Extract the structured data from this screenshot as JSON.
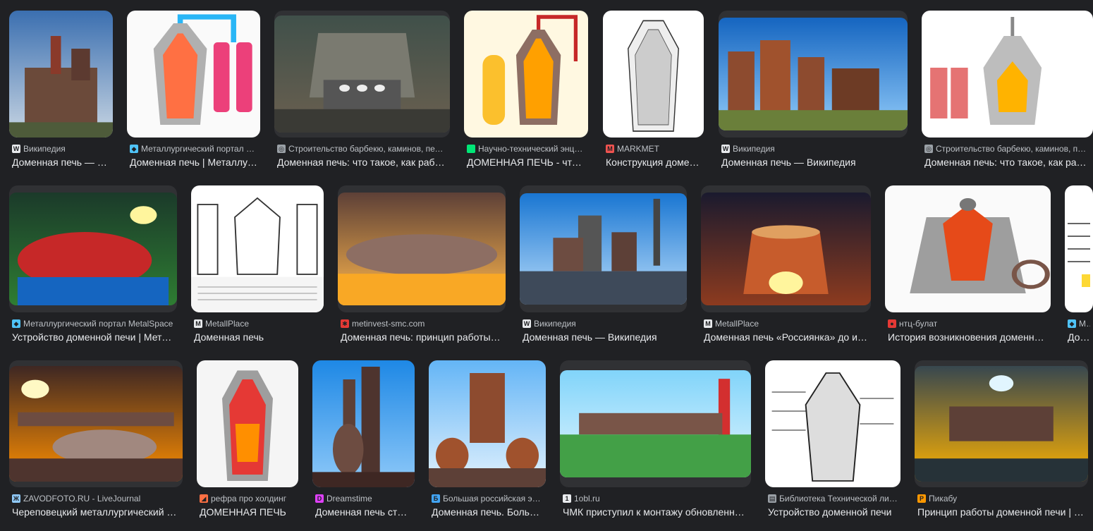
{
  "rows": [
    {
      "tiles": [
        {
          "source": "Википедия",
          "title": "Доменная печь — Википедия",
          "favicon": "wikipedia-icon",
          "fav_color": "#e8eaed",
          "fav_char": "W",
          "img": "furnace-outdoor-blue-sky"
        },
        {
          "source": "Металлургический портал MetalSpace",
          "title": "Доменная печь | Металлургический портал",
          "favicon": "diamond-icon",
          "fav_color": "#4fc3f7",
          "fav_char": "◆",
          "img": "furnace-diagram-color"
        },
        {
          "source": "Строительство барбекю, каминов, печей",
          "title": "Доменная печь: что такое, как работает",
          "favicon": "globe-icon",
          "fav_color": "#9aa0a6",
          "fav_char": "◎",
          "img": "furnace-people-hall"
        },
        {
          "source": "Научно-технический энциклопедический",
          "title": "ДОМЕННАЯ ПЕЧЬ - что это такое",
          "favicon": "square-green-icon",
          "fav_color": "#00e676",
          "fav_char": "",
          "img": "furnace-diagram-yellow"
        },
        {
          "source": "MARKMET",
          "title": "Конструкция доменной печи",
          "favicon": "markmet-icon",
          "fav_color": "#ef5350",
          "fav_char": "M",
          "img": "furnace-drawing-bw"
        },
        {
          "source": "Википедия",
          "title": "Доменная печь — Википедия",
          "favicon": "wikipedia-icon",
          "fav_color": "#e8eaed",
          "fav_char": "W",
          "img": "furnace-rusty-blue-sky"
        },
        {
          "source": "Строительство барбекю, каминов, печей",
          "title": "Доменная печь: что такое, как работает",
          "favicon": "globe-icon",
          "fav_color": "#9aa0a6",
          "fav_char": "◎",
          "img": "furnace-diagram-labeled"
        }
      ]
    },
    {
      "tiles": [
        {
          "source": "Металлургический портал MetalSpace",
          "title": "Устройство доменной печи | Металлургический",
          "favicon": "diamond-icon",
          "fav_color": "#4fc3f7",
          "fav_char": "◆",
          "img": "furnace-interior-green"
        },
        {
          "source": "MetallPlace",
          "title": "Доменная печь",
          "favicon": "metallplace-icon",
          "fav_color": "#e8eaed",
          "fav_char": "M",
          "img": "furnace-scheme-bw"
        },
        {
          "source": "metinvest-smc.com",
          "title": "Доменная печь: принцип работы и устройство",
          "favicon": "metinvest-icon",
          "fav_color": "#e53935",
          "fav_char": "✱",
          "img": "furnace-interior-orange"
        },
        {
          "source": "Википедия",
          "title": "Доменная печь — Википедия",
          "favicon": "wikipedia-icon",
          "fav_color": "#e8eaed",
          "fav_char": "W",
          "img": "furnace-plant-blue-sky"
        },
        {
          "source": "MetallPlace",
          "title": "Доменная печь «Россиянка» до и после",
          "favicon": "metallplace-icon",
          "fav_color": "#e8eaed",
          "fav_char": "M",
          "img": "furnace-rossiyanka"
        },
        {
          "source": "нтц-булат",
          "title": "История возникновения доменной печи",
          "favicon": "bulat-icon",
          "fav_color": "#e53935",
          "fav_char": "●",
          "img": "furnace-cutaway-ancient"
        },
        {
          "source": "Металлургический портал",
          "title": "Доменная печь",
          "favicon": "diamond-icon",
          "fav_color": "#4fc3f7",
          "fav_char": "◆",
          "img": "furnace-diagram-partial"
        }
      ]
    },
    {
      "tiles": [
        {
          "source": "ZAVODFOTO.RU - LiveJournal",
          "title": "Череповецкий металлургический комбинат",
          "favicon": "livejournal-icon",
          "fav_color": "#90caf9",
          "fav_char": "Ж",
          "img": "furnace-cherepovets"
        },
        {
          "source": "рефра про холдинг",
          "title": "ДОМЕННАЯ ПЕЧЬ",
          "favicon": "refra-icon",
          "fav_color": "#ff7043",
          "fav_char": "◢",
          "img": "furnace-scheme-red"
        },
        {
          "source": "Dreamstime",
          "title": "Доменная печь стоковое фото",
          "favicon": "dreamstime-icon",
          "fav_color": "#e040fb",
          "fav_char": "D",
          "img": "furnace-tower-sky"
        },
        {
          "source": "Большая российская энциклопедия",
          "title": "Доменная печь. Большая российская энциклопедия",
          "favicon": "bre-icon",
          "fav_color": "#42a5f5",
          "fav_char": "Б",
          "img": "furnace-tall-rusty"
        },
        {
          "source": "1obl.ru",
          "title": "ЧМК приступил к монтажу обновленной доменной печи",
          "favicon": "1obl-icon",
          "fav_color": "#e8eaed",
          "fav_char": "1",
          "img": "furnace-chimney-green"
        },
        {
          "source": "Библиотека Технической литературы",
          "title": "Устройство доменной печи",
          "favicon": "library-icon",
          "fav_color": "#9aa0a6",
          "fav_char": "▤",
          "img": "furnace-drawing-labeled-bw"
        },
        {
          "source": "Пикабу",
          "title": "Принцип работы доменной печи | Пикабу",
          "favicon": "pikabu-icon",
          "fav_color": "#ff9800",
          "fav_char": "P",
          "img": "furnace-interior-blue-light"
        }
      ]
    }
  ]
}
